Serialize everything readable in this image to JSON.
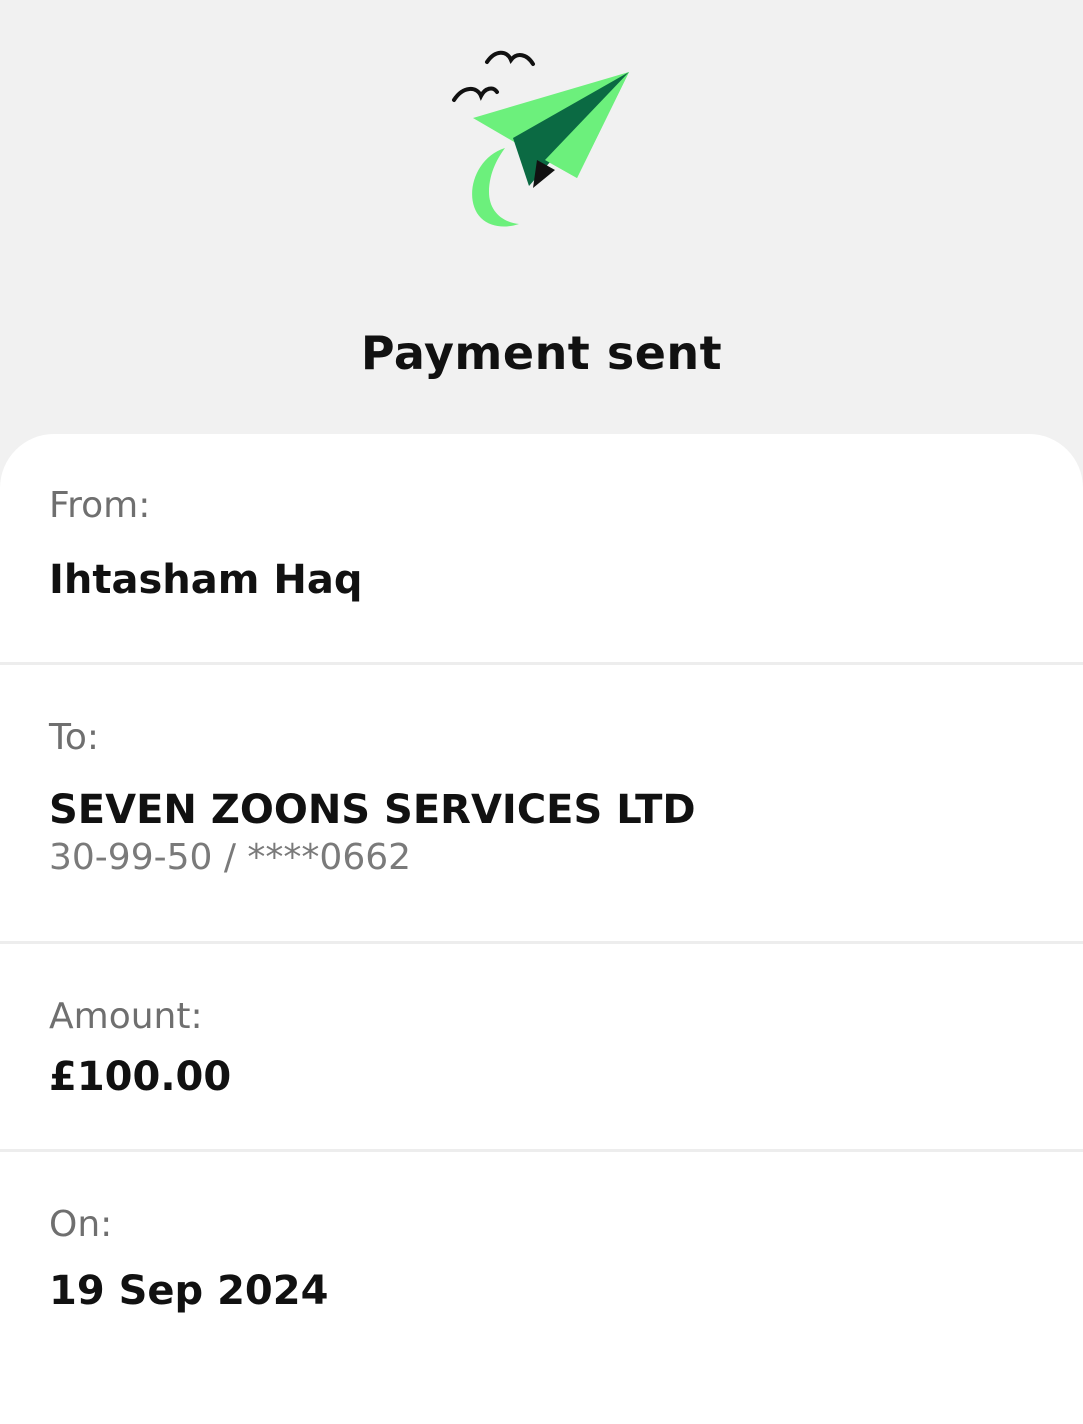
{
  "header": {
    "title": "Payment sent",
    "icon": "paper-plane-icon",
    "colors": {
      "plane_light": "#6cf07c",
      "plane_dark": "#0b6a43",
      "birds": "#111111"
    }
  },
  "details": {
    "from": {
      "label": "From:",
      "value": "Ihtasham Haq"
    },
    "to": {
      "label": "To:",
      "value": "SEVEN ZOONS SERVICES LTD",
      "account": "30-99-50 / ****0662"
    },
    "amount": {
      "label": "Amount:",
      "value": "£100.00"
    },
    "on": {
      "label": "On:",
      "value": "19 Sep 2024"
    }
  }
}
